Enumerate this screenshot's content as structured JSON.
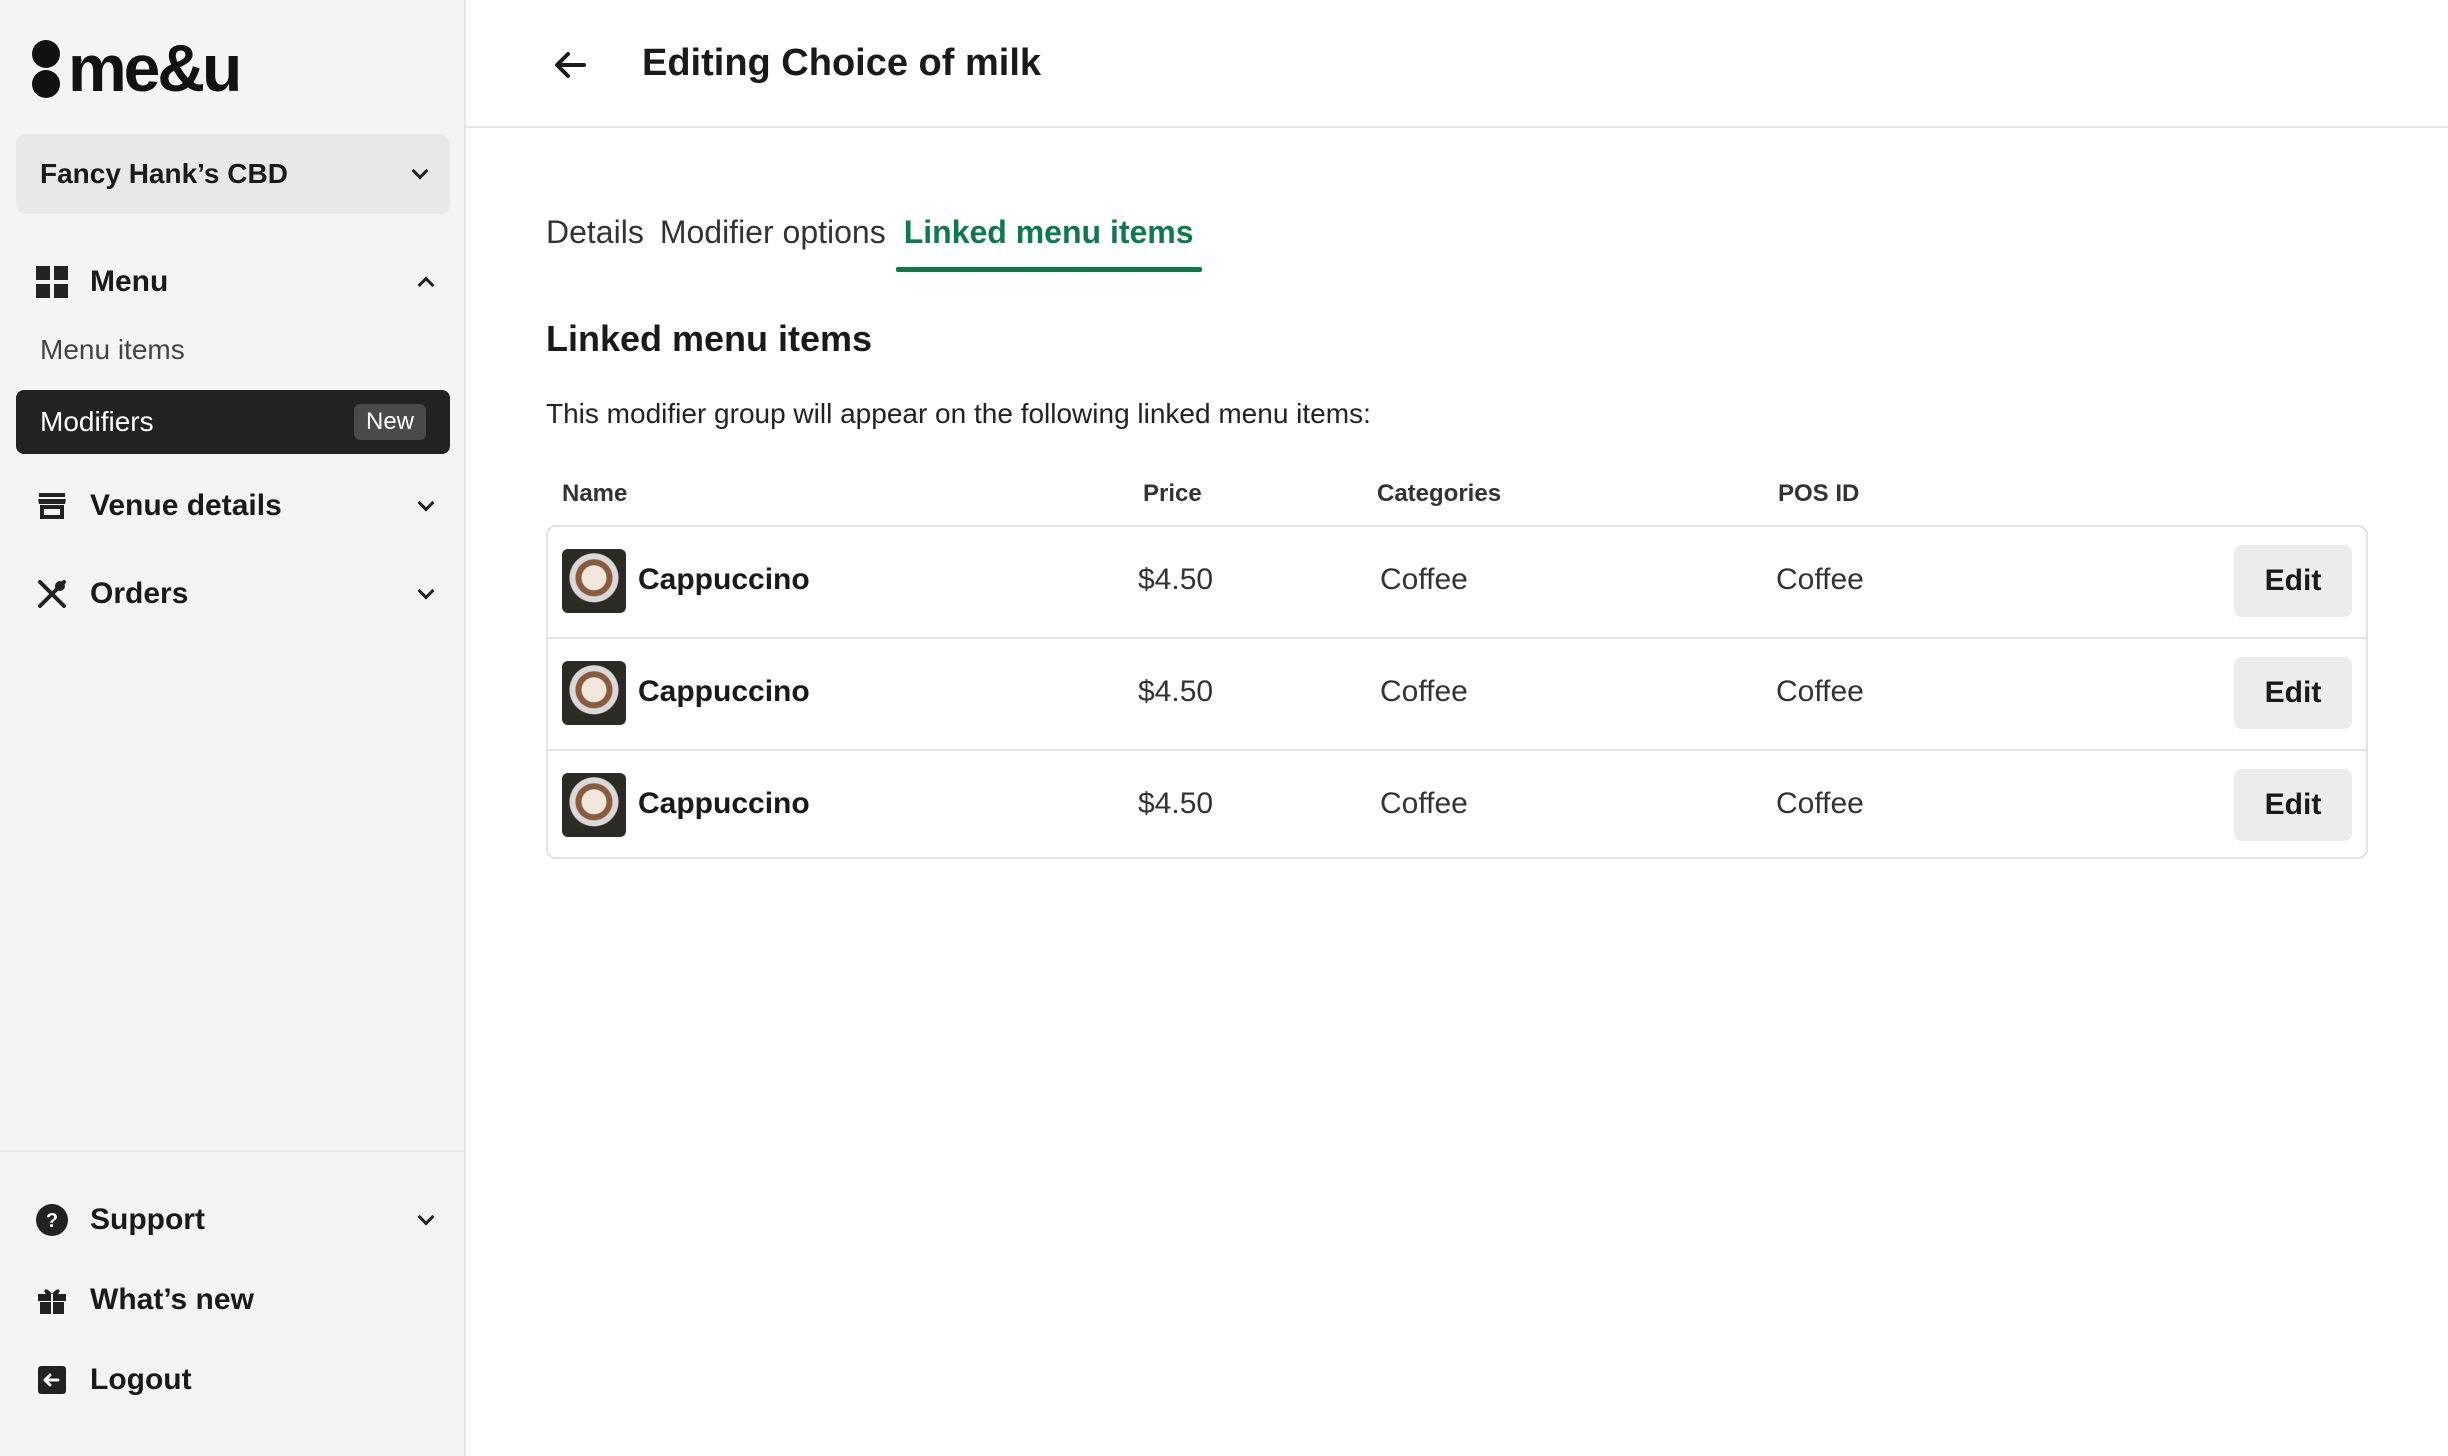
{
  "brand": {
    "logo_text": "me&u"
  },
  "venue": {
    "name": "Fancy Hank’s CBD"
  },
  "sidebar": {
    "menu": {
      "label": "Menu",
      "items": [
        {
          "label": "Menu items"
        },
        {
          "label": "Modifiers",
          "badge": "New"
        }
      ]
    },
    "venue_details": {
      "label": "Venue details"
    },
    "orders": {
      "label": "Orders"
    },
    "support": {
      "label": "Support"
    },
    "whats_new": {
      "label": "What’s new"
    },
    "logout": {
      "label": "Logout"
    }
  },
  "header": {
    "title": "Editing Choice of milk"
  },
  "tabs": [
    {
      "label": "Details"
    },
    {
      "label": "Modifier options"
    },
    {
      "label": "Linked menu items"
    }
  ],
  "section": {
    "title": "Linked menu items",
    "description": "This modifier group will appear on the following linked menu items:"
  },
  "table": {
    "columns": [
      "Name",
      "Price",
      "Categories",
      "POS ID"
    ],
    "rows": [
      {
        "name": "Cappuccino",
        "price": "$4.50",
        "category": "Coffee",
        "pos_id": "Coffee",
        "action": "Edit"
      },
      {
        "name": "Cappuccino",
        "price": "$4.50",
        "category": "Coffee",
        "pos_id": "Coffee",
        "action": "Edit"
      },
      {
        "name": "Cappuccino",
        "price": "$4.50",
        "category": "Coffee",
        "pos_id": "Coffee",
        "action": "Edit"
      }
    ]
  },
  "colors": {
    "accent": "#0e7a4c",
    "active_nav": "#222222",
    "sidebar_bg": "#f4f4f4"
  }
}
